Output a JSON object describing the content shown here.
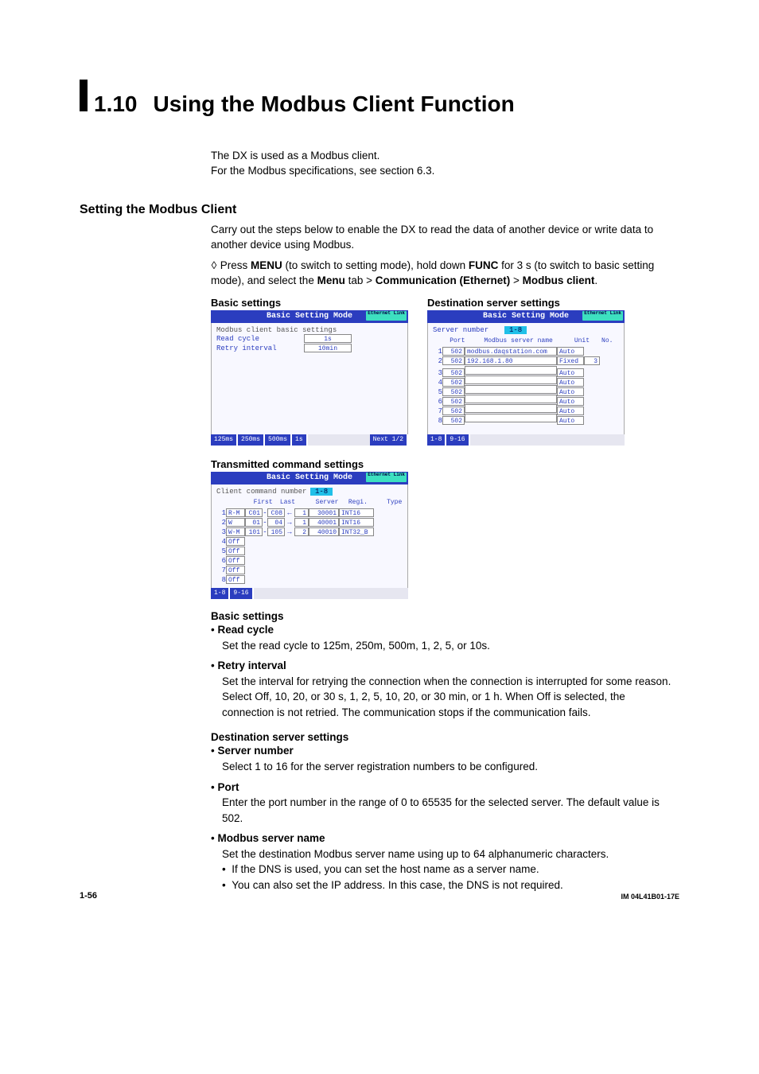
{
  "chapter": {
    "num": "1.10",
    "title": "Using the Modbus Client Function"
  },
  "intro": {
    "l1": "The DX is used as a Modbus client.",
    "l2": "For the Modbus specifications, see section 6.3."
  },
  "h2_1": "Setting the Modbus Client",
  "para1": "Carry out the steps below to enable the DX to read the data of another device or write data to another device using Modbus.",
  "step1_pre": "Press ",
  "step1_b1": "MENU",
  "step1_mid1": " (to switch to setting mode), hold down ",
  "step1_b2": "FUNC",
  "step1_mid2": " for 3 s (to switch to basic setting mode), and select the ",
  "step1_b3": "Menu",
  "step1_mid3": " tab > ",
  "step1_b4": "Communication (Ethernet)",
  "step1_mid4": " > ",
  "step1_b5": "Modbus client",
  "step1_end": ".",
  "screens": {
    "basic": {
      "caption": "Basic settings",
      "title": "Basic Setting Mode",
      "eth": "Ethernet Link",
      "subtitle": "Modbus client basic settings",
      "read_cycle_label": "Read cycle",
      "read_cycle_val": "1s",
      "retry_label": "Retry interval",
      "retry_val": "10min",
      "footer": [
        "125ms",
        "250ms",
        "500ms",
        "1s"
      ],
      "footer_next": "Next 1/2"
    },
    "dest": {
      "caption": "Destination server settings",
      "title": "Basic Setting Mode",
      "eth": "Ethernet Link",
      "server_number_label": "Server number",
      "server_number_val": "1-8",
      "cols": {
        "port": "Port",
        "name": "Modbus server name",
        "unit": "Unit",
        "no": "No."
      },
      "rows": [
        {
          "i": "1",
          "port": "502",
          "name": "modbus.daqstation.com",
          "unit": "Auto",
          "no": ""
        },
        {
          "i": "2",
          "port": "502",
          "name": "192.168.1.80",
          "unit": "Fixed",
          "no": "3"
        },
        {
          "i": "3",
          "port": "502",
          "name": "",
          "unit": "Auto",
          "no": ""
        },
        {
          "i": "4",
          "port": "502",
          "name": "",
          "unit": "Auto",
          "no": ""
        },
        {
          "i": "5",
          "port": "502",
          "name": "",
          "unit": "Auto",
          "no": ""
        },
        {
          "i": "6",
          "port": "502",
          "name": "",
          "unit": "Auto",
          "no": ""
        },
        {
          "i": "7",
          "port": "502",
          "name": "",
          "unit": "Auto",
          "no": ""
        },
        {
          "i": "8",
          "port": "502",
          "name": "",
          "unit": "Auto",
          "no": ""
        }
      ],
      "footer": [
        "1-8",
        "9-16"
      ]
    },
    "trans": {
      "caption": "Transmitted command settings",
      "title": "Basic Setting Mode",
      "eth": "Ethernet Link",
      "client_cmd_label": "Client command number",
      "client_cmd_val": "1-8",
      "cols": {
        "first": "First",
        "last": "Last",
        "server": "Server",
        "regi": "Regi.",
        "type": "Type"
      },
      "rows": [
        {
          "i": "1",
          "mode": "R-M",
          "first": "C01",
          "last": "C08",
          "arrow": "←",
          "server": "1",
          "regi": "30001",
          "type": "INT16"
        },
        {
          "i": "2",
          "mode": "W",
          "first": "01",
          "last": "04",
          "arrow": "→",
          "server": "1",
          "regi": "40001",
          "type": "INT16"
        },
        {
          "i": "3",
          "mode": "W-M",
          "first": "101",
          "last": "105",
          "arrow": "→",
          "server": "2",
          "regi": "40010",
          "type": "INT32_B"
        },
        {
          "i": "4",
          "mode": "Off"
        },
        {
          "i": "5",
          "mode": "Off"
        },
        {
          "i": "6",
          "mode": "Off"
        },
        {
          "i": "7",
          "mode": "Off"
        },
        {
          "i": "8",
          "mode": "Off"
        }
      ],
      "footer": [
        "1-8",
        "9-16"
      ]
    }
  },
  "basic_h": "Basic settings",
  "read_cycle": {
    "h": "Read cycle",
    "t": "Set the read cycle to 125m, 250m, 500m, 1, 2, 5, or 10s."
  },
  "retry": {
    "h": "Retry interval",
    "t": "Set the interval for retrying the connection when the connection is interrupted for some reason.  Select Off, 10, 20, or 30 s, 1, 2, 5, 10, 20, or 30 min, or 1 h. When Off is selected, the connection is not retried. The communication stops if the communication fails."
  },
  "dest_h": "Destination server settings",
  "srvnum": {
    "h": "Server number",
    "t": "Select 1 to 16 for the server registration numbers to be configured."
  },
  "port": {
    "h": "Port",
    "t": "Enter the port number in the range of 0 to 65535 for the selected server.  The default value is 502."
  },
  "msn": {
    "h": "Modbus server name",
    "t": "Set the destination Modbus server name using up to 64 alphanumeric characters.",
    "s1": "If the DNS is used, you can set the host name as a server name.",
    "s2": "You can also set the IP address.  In this case, the DNS is not required."
  },
  "page_num": "1-56",
  "doc_id": "IM 04L41B01-17E"
}
